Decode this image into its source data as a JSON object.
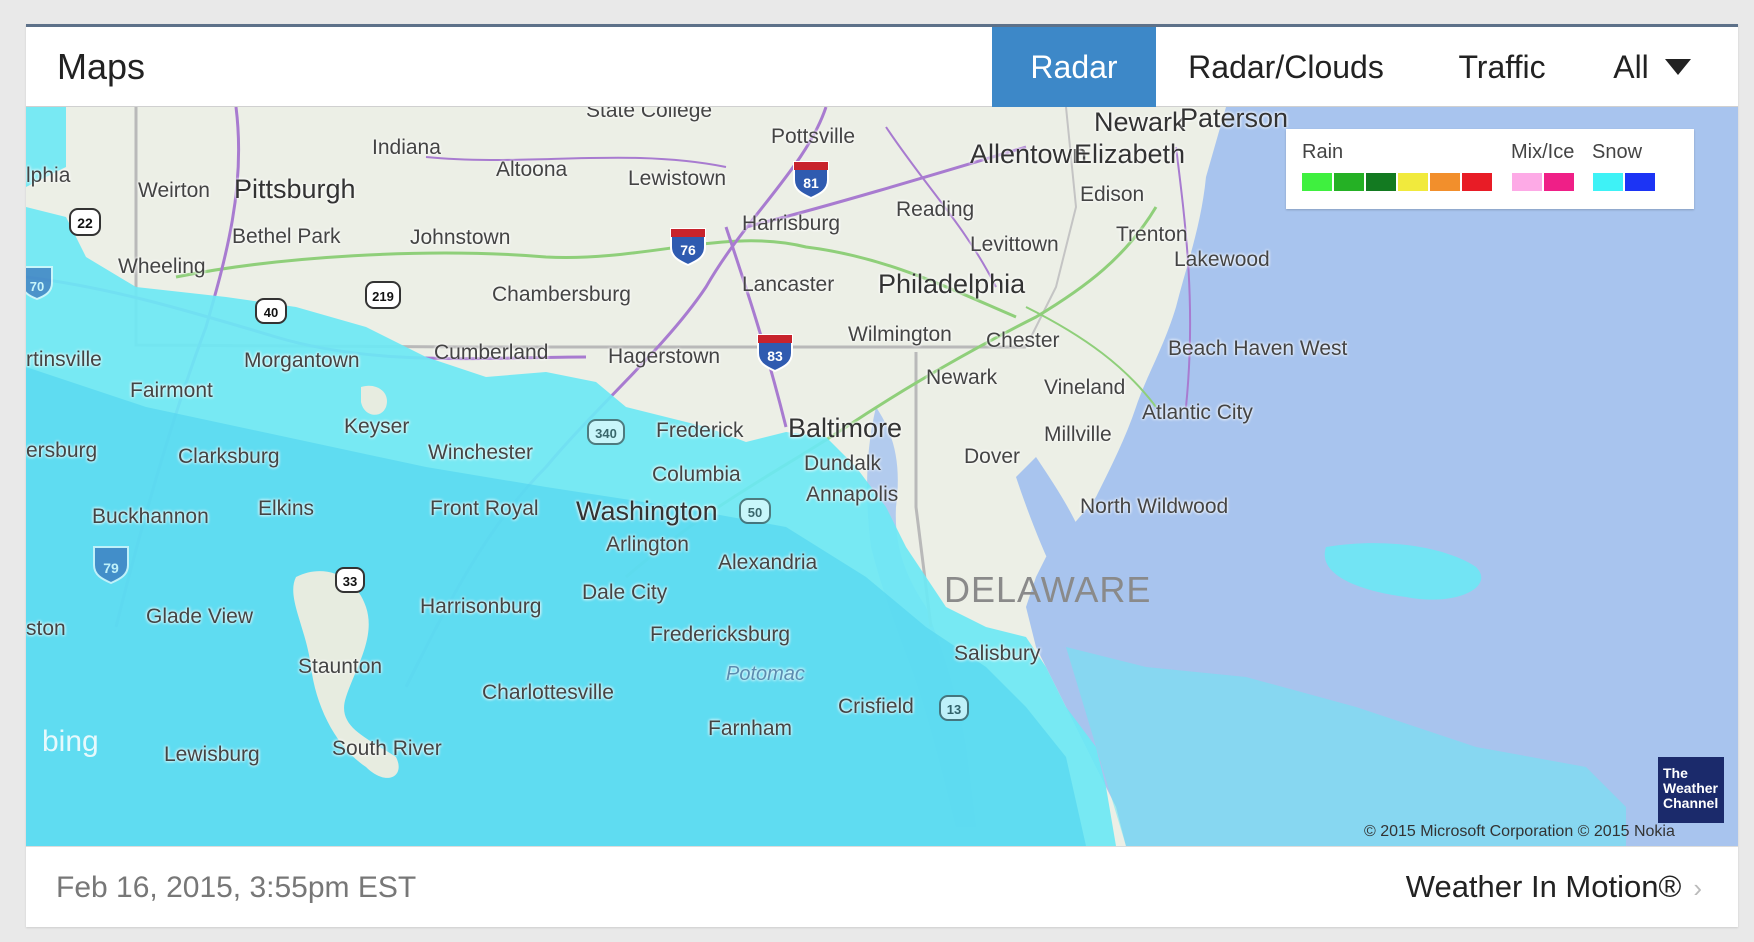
{
  "header": {
    "title": "Maps",
    "tabs": [
      {
        "label": "Radar",
        "active": true
      },
      {
        "label": "Radar/Clouds",
        "active": false
      },
      {
        "label": "Traffic",
        "active": false
      },
      {
        "label": "All",
        "active": false
      }
    ]
  },
  "legend": {
    "rain_label": "Rain",
    "mix_label": "Mix/Ice",
    "snow_label": "Snow",
    "rain_colors": [
      "#3ff03f",
      "#25b125",
      "#137a21",
      "#f1ea3d",
      "#f28f2c",
      "#e81c26"
    ],
    "mix_colors": [
      "#fdaae6",
      "#ef1f87"
    ],
    "snow_colors": [
      "#3ef2f6",
      "#1c34f5"
    ]
  },
  "map": {
    "labels": {
      "state_college": "State College",
      "pottsville": "Pottsville",
      "newark_nj": "Newark",
      "paterson": "Paterson",
      "indiana": "Indiana",
      "philadelphia_edge": "lphia",
      "weirton": "Weirton",
      "pittsburgh": "Pittsburgh",
      "altoona": "Altoona",
      "lewistown": "Lewistown",
      "allentown": "Allentown",
      "elizabeth": "Elizabeth",
      "edison": "Edison",
      "bethel_park": "Bethel Park",
      "johnstown": "Johnstown",
      "harrisburg": "Harrisburg",
      "reading": "Reading",
      "trenton": "Trenton",
      "wheeling": "Wheeling",
      "levittown": "Levittown",
      "lakewood": "Lakewood",
      "chambersburg": "Chambersburg",
      "lancaster": "Lancaster",
      "philadelphia": "Philadelphia",
      "wilmington": "Wilmington",
      "chester": "Chester",
      "beach_haven_west": "Beach Haven West",
      "martinsville": "rtinsville",
      "morgantown": "Morgantown",
      "cumberland": "Cumberland",
      "hagerstown": "Hagerstown",
      "newark_de": "Newark",
      "vineland": "Vineland",
      "fairmont": "Fairmont",
      "keyser": "Keyser",
      "atlantic_city": "Atlantic City",
      "frederick": "Frederick",
      "baltimore": "Baltimore",
      "millville": "Millville",
      "parkersburg": "ersburg",
      "clarksburg": "Clarksburg",
      "winchester": "Winchester",
      "dover": "Dover",
      "columbia": "Columbia",
      "dundalk": "Dundalk",
      "annapolis": "Annapolis",
      "buckhannon": "Buckhannon",
      "elkins": "Elkins",
      "front_royal": "Front Royal",
      "washington": "Washington",
      "north_wildwood": "North Wildwood",
      "arlington": "Arlington",
      "alexandria": "Alexandria",
      "delaware": "DELAWARE",
      "dale_city": "Dale City",
      "harrisonburg": "Harrisonburg",
      "glade_view": "Glade View",
      "ston": "ston",
      "fredericksburg": "Fredericksburg",
      "salisbury": "Salisbury",
      "staunton": "Staunton",
      "potomac": "Potomac",
      "charlottesville": "Charlottesville",
      "crisfield": "Crisfield",
      "farnham": "Farnham",
      "lewisburg": "Lewisburg",
      "south_river": "South River"
    },
    "shields": {
      "i81": "81",
      "i76": "76",
      "i83": "83",
      "i79": "79",
      "i70": "70",
      "us22": "22",
      "us219": "219",
      "us40": "40",
      "us340": "340",
      "us50": "50",
      "us33": "33",
      "us13": "13"
    },
    "bing_label": "bing",
    "copyright": "© 2015 Microsoft Corporation © 2015 Nokia",
    "twc_logo": "The Weather Channel",
    "colors": {
      "land": "#ecefe6",
      "ocean": "#a8c4ee",
      "snow_light": "#6ce8f4",
      "snow_mid": "#56d6ef",
      "road_interstate": "#a87bd0",
      "road_highway": "#8fcf7a"
    }
  },
  "footer": {
    "timestamp": "Feb 16, 2015, 3:55pm EST",
    "link_label": "Weather In Motion®",
    "chevron": "›"
  }
}
